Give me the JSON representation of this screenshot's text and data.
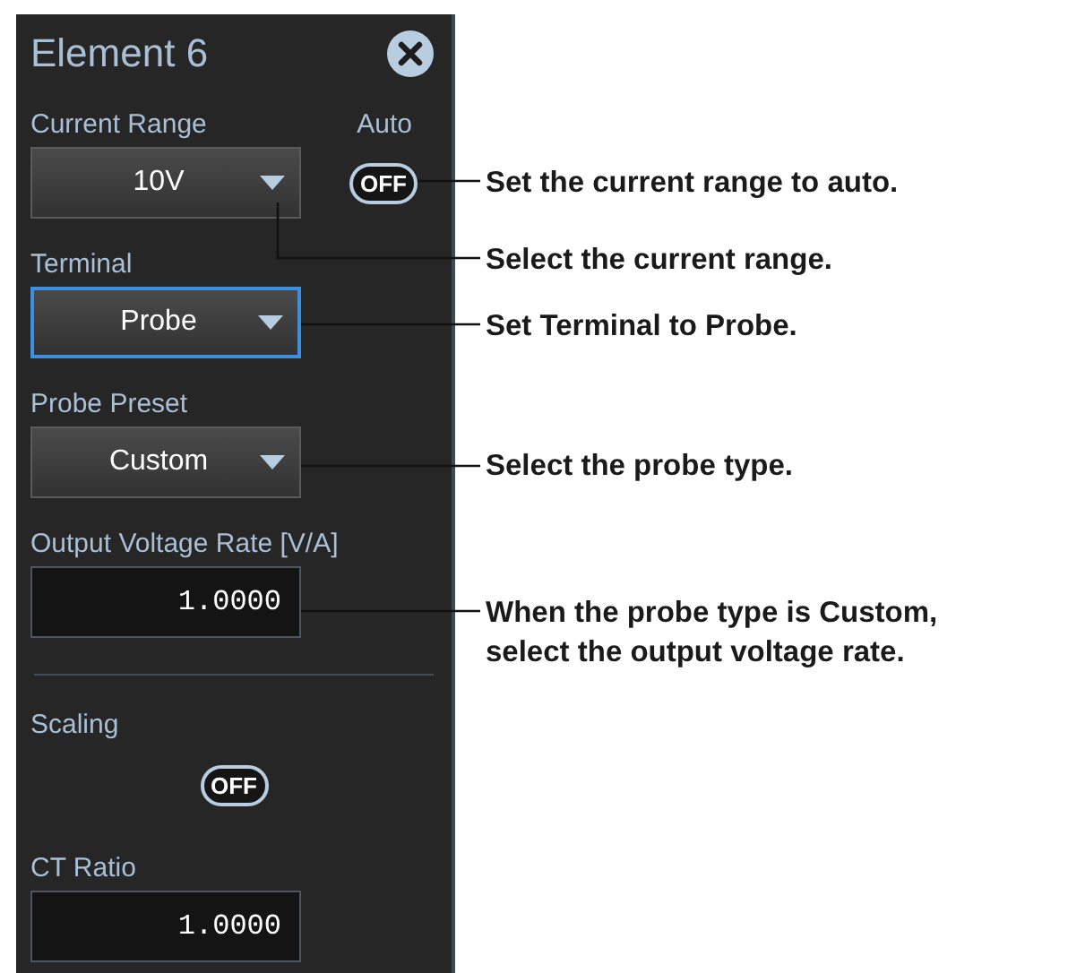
{
  "panel": {
    "title": "Element 6",
    "current_range": {
      "label": "Current Range",
      "value": "10V",
      "focused": false,
      "auto_label": "Auto",
      "auto": {
        "text": "OFF",
        "on": false
      }
    },
    "terminal": {
      "label": "Terminal",
      "value": "Probe",
      "focused": true
    },
    "probe_preset": {
      "label": "Probe Preset",
      "value": "Custom",
      "focused": false
    },
    "output_voltage_rate": {
      "label": "Output Voltage Rate [V/A]",
      "value": "1.0000"
    },
    "scaling": {
      "label": "Scaling",
      "toggle": {
        "text": "OFF",
        "on": false
      }
    },
    "ct_ratio": {
      "label": "CT Ratio",
      "value": "1.0000"
    }
  },
  "annotations": [
    {
      "text": "Set the current range to auto."
    },
    {
      "text": "Select the current range."
    },
    {
      "text": "Set Terminal to Probe."
    },
    {
      "text": "Select the probe type."
    },
    {
      "text": "When the probe type is Custom,\nselect the output voltage rate."
    }
  ]
}
